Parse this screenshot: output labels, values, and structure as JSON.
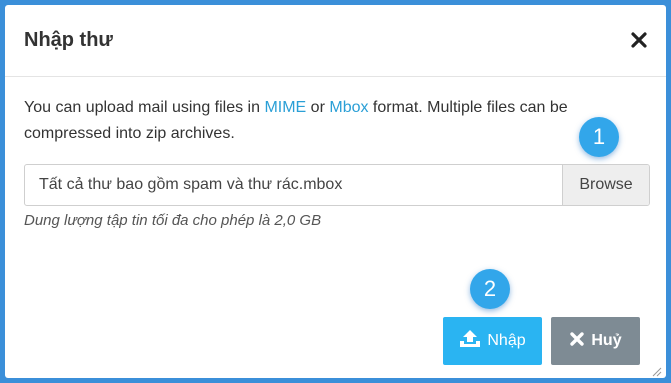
{
  "dialog": {
    "title": "Nhập thư",
    "intro": {
      "part1": "You can upload mail using files in ",
      "link_mime": "MIME",
      "part2": " or ",
      "link_mbox": "Mbox",
      "part3": " format. Multiple files can be compressed into zip archives."
    },
    "file_input": {
      "value": "Tất cả thư bao gồm spam và thư rác.mbox",
      "browse_label": "Browse"
    },
    "hint": "Dung lượng tập tin tối đa cho phép là 2,0 GB",
    "buttons": {
      "import_label": "Nhập",
      "cancel_label": "Huỷ"
    },
    "step_badges": [
      "1",
      "2"
    ]
  },
  "icons": {
    "close": "close-icon",
    "upload": "upload-icon",
    "cancel": "x-icon",
    "resize": "resize-handle-icon"
  },
  "colors": {
    "outer_background": "#3b8fd9",
    "link": "#2a9fd6",
    "import_button": "#2ab4f2",
    "cancel_button": "#7e8b94",
    "badge": "#32a6ea"
  }
}
